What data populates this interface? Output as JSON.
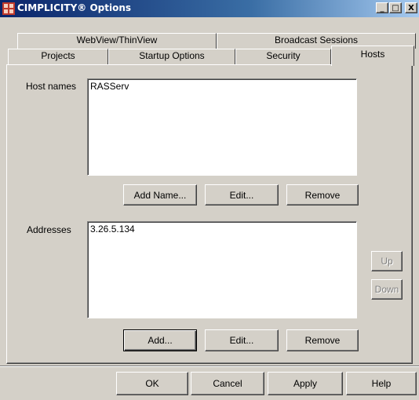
{
  "window": {
    "title": "CIMPLICITY® Options",
    "minimize_label": "_",
    "maximize_label": "□",
    "close_label": "X"
  },
  "tabs": {
    "row_back": [
      {
        "label": "WebView/ThinView"
      },
      {
        "label": "Broadcast Sessions"
      }
    ],
    "row_front": [
      {
        "label": "Projects"
      },
      {
        "label": "Startup Options"
      },
      {
        "label": "Security"
      },
      {
        "label": "Hosts",
        "selected": true
      }
    ]
  },
  "hosts": {
    "host_names_label": "Host names",
    "host_names": [
      "RASServ"
    ],
    "add_name_label": "Add Name...",
    "edit_name_label": "Edit...",
    "remove_name_label": "Remove",
    "addresses_label": "Addresses",
    "addresses": [
      "3.26.5.134"
    ],
    "add_address_label": "Add...",
    "edit_address_label": "Edit...",
    "remove_address_label": "Remove",
    "up_label": "Up",
    "down_label": "Down"
  },
  "footer": {
    "ok_label": "OK",
    "cancel_label": "Cancel",
    "apply_label": "Apply",
    "help_label": "Help"
  },
  "colors": {
    "titlebar_start": "#0a246a",
    "titlebar_end": "#a6caf0",
    "face": "#d4d0c8",
    "app_icon": "#c0392b"
  }
}
